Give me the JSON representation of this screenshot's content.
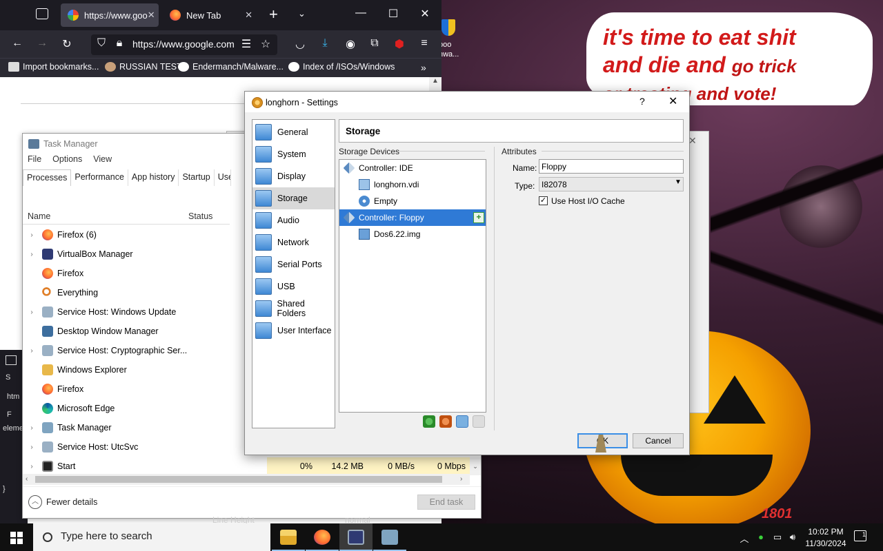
{
  "desktop": {
    "speech": {
      "line1": "it's time to eat shit",
      "line2a": "and die and",
      "line2b": "go trick",
      "line3": "or treating and vote!"
    },
    "icon_label": "boo\nnwa...",
    "bottom_text": "1801"
  },
  "firefox": {
    "tabs": [
      {
        "label": "https://www.goo",
        "icon": "google-icon"
      },
      {
        "label": "New Tab",
        "icon": "firefox-icon"
      }
    ],
    "url": "https://www.google.com",
    "bookmarks": [
      {
        "label": "Import bookmarks...",
        "icon": "import-icon"
      },
      {
        "label": "RUSSIAN TEST",
        "icon": "globe-icon"
      },
      {
        "label": "Endermanch/Malware...",
        "icon": "github-icon"
      },
      {
        "label": "Index of /ISOs/Windows",
        "icon": "globe-icon"
      }
    ],
    "window_controls": {
      "min": "—",
      "max": "☐",
      "close": "✕"
    },
    "devtools": {
      "items": [
        "S",
        "htm",
        "F",
        "eleme",
        "}"
      ]
    }
  },
  "task_manager": {
    "title": "Task Manager",
    "menu": [
      "File",
      "Options",
      "View"
    ],
    "tabs": [
      "Processes",
      "Performance",
      "App history",
      "Startup",
      "User"
    ],
    "columns": {
      "name": "Name",
      "status": "Status"
    },
    "rows": [
      {
        "name": "Firefox (6)",
        "icon": "firefox",
        "expand": true
      },
      {
        "name": "VirtualBox Manager",
        "icon": "vbox",
        "expand": true
      },
      {
        "name": "Firefox",
        "icon": "firefox",
        "expand": false
      },
      {
        "name": "Everything",
        "icon": "search",
        "expand": false
      },
      {
        "name": "Service Host: Windows Update",
        "icon": "gear",
        "expand": true
      },
      {
        "name": "Desktop Window Manager",
        "icon": "dwm",
        "expand": false
      },
      {
        "name": "Service Host: Cryptographic Ser...",
        "icon": "gear",
        "expand": true
      },
      {
        "name": "Windows Explorer",
        "icon": "explorer",
        "expand": false
      },
      {
        "name": "Firefox",
        "icon": "firefox",
        "expand": false
      },
      {
        "name": "Microsoft Edge",
        "icon": "edge",
        "expand": false
      },
      {
        "name": "Task Manager",
        "icon": "tm",
        "expand": true
      },
      {
        "name": "Service Host: UtcSvc",
        "icon": "gear",
        "expand": true
      },
      {
        "name": "Start",
        "icon": "start",
        "expand": true
      }
    ],
    "stats": {
      "cpu": "0%",
      "memory": "14.2 MB",
      "disk": "0 MB/s",
      "network": "0 Mbps"
    },
    "fewer_details": "Fewer details",
    "end_task": "End task"
  },
  "settings": {
    "title": "longhorn - Settings",
    "help": "?",
    "close": "✕",
    "nav": [
      {
        "label": "General",
        "selected": false
      },
      {
        "label": "System",
        "selected": false
      },
      {
        "label": "Display",
        "selected": false
      },
      {
        "label": "Storage",
        "selected": true
      },
      {
        "label": "Audio",
        "selected": false
      },
      {
        "label": "Network",
        "selected": false
      },
      {
        "label": "Serial Ports",
        "selected": false
      },
      {
        "label": "USB",
        "selected": false
      },
      {
        "label": "Shared Folders",
        "selected": false
      },
      {
        "label": "User Interface",
        "selected": false
      }
    ],
    "heading": "Storage",
    "storage_devices_label": "Storage Devices",
    "tree": [
      {
        "label": "Controller: IDE",
        "type": "controller",
        "indent": 0,
        "selected": false
      },
      {
        "label": "longhorn.vdi",
        "type": "hdd",
        "indent": 1,
        "selected": false
      },
      {
        "label": "Empty",
        "type": "cd",
        "indent": 1,
        "selected": false
      },
      {
        "label": "Controller: Floppy",
        "type": "controller",
        "indent": 0,
        "selected": true
      },
      {
        "label": "Dos6.22.img",
        "type": "floppy",
        "indent": 1,
        "selected": false
      }
    ],
    "attributes_label": "Attributes",
    "name_label": "Name:",
    "name_value": "Floppy",
    "type_label": "Type:",
    "type_value": "I82078",
    "use_host_io_cache_label": "Use Host I/O Cache",
    "use_host_io_cache": true,
    "ok": "OK",
    "cancel": "Cancel"
  },
  "background_text": {
    "line_height": "Line Height",
    "normal": "normal"
  },
  "taskbar": {
    "search_placeholder": "Type here to search",
    "apps": [
      "file-explorer",
      "firefox",
      "virtualbox",
      "task-manager"
    ],
    "time": "10:02 PM",
    "date": "11/30/2024",
    "notification_count": "1"
  },
  "colors": {
    "accent": "#2f7ad6",
    "speech_text": "#d21a1a",
    "firefox_dark": "#1c1b22"
  }
}
